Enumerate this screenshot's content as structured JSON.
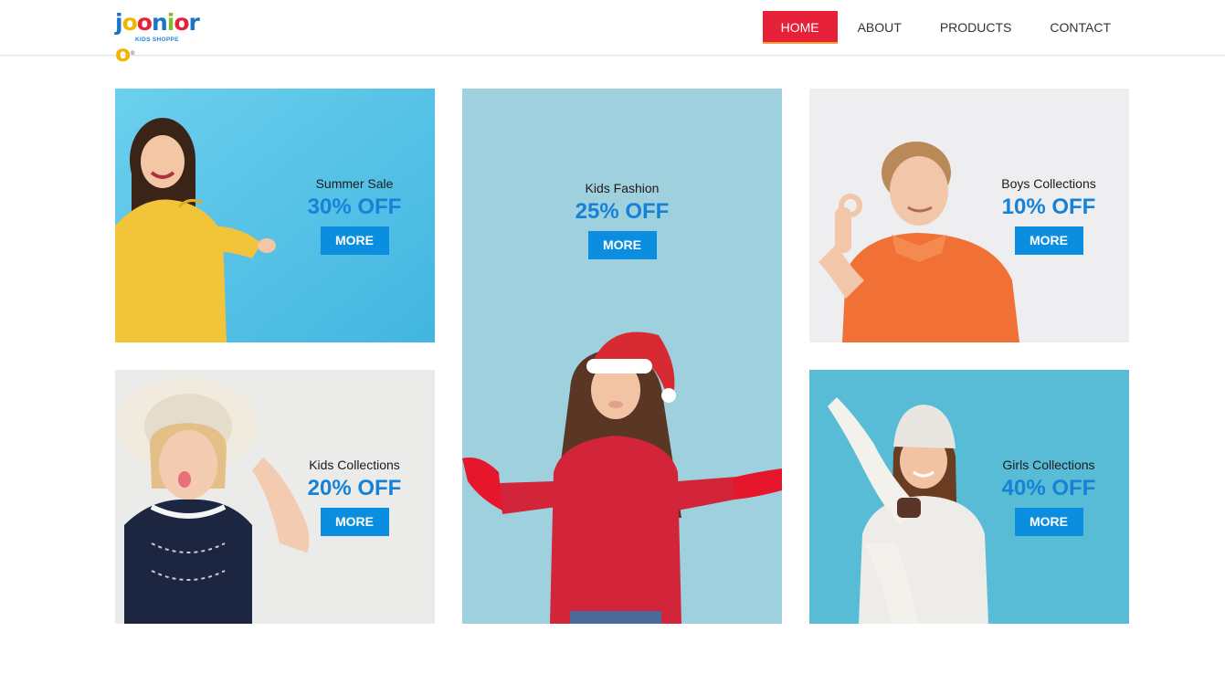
{
  "brand": {
    "logo_letters": [
      "j",
      "o",
      "o",
      "n",
      "i",
      "o",
      "r",
      "o"
    ],
    "logo_colors": [
      "#1a74c9",
      "#f2b600",
      "#e8213b",
      "#1a74c9",
      "#7dbf24",
      "#e8213b",
      "#1a74c9",
      "#f2b600"
    ],
    "tagline": "KIDS SHOPPE",
    "registered": "®"
  },
  "nav": {
    "items": [
      {
        "label": "HOME",
        "active": true
      },
      {
        "label": "ABOUT",
        "active": false
      },
      {
        "label": "PRODUCTS",
        "active": false
      },
      {
        "label": "CONTACT",
        "active": false
      }
    ]
  },
  "cards": [
    {
      "id": "summer-sale",
      "subtitle": "Summer Sale",
      "discount": "30% OFF",
      "button": "MORE",
      "bg": "#55c2e6"
    },
    {
      "id": "kids-fashion",
      "subtitle": "Kids Fashion",
      "discount": "25% OFF",
      "button": "MORE",
      "bg": "#9fd0de"
    },
    {
      "id": "boys-collections",
      "subtitle": "Boys Collections",
      "discount": "10% OFF",
      "button": "MORE",
      "bg": "#eeeef0"
    },
    {
      "id": "kids-collections",
      "subtitle": "Kids Collections",
      "discount": "20% OFF",
      "button": "MORE",
      "bg": "#ebebea"
    },
    {
      "id": "girls-collections",
      "subtitle": "Girls Collections",
      "discount": "40% OFF",
      "button": "MORE",
      "bg": "#58bcd6"
    }
  ],
  "colors": {
    "nav_active": "#e8213b",
    "nav_active_underline": "#f2a33a",
    "accent_blue": "#1582d8",
    "button_blue": "#0b8ee0"
  }
}
